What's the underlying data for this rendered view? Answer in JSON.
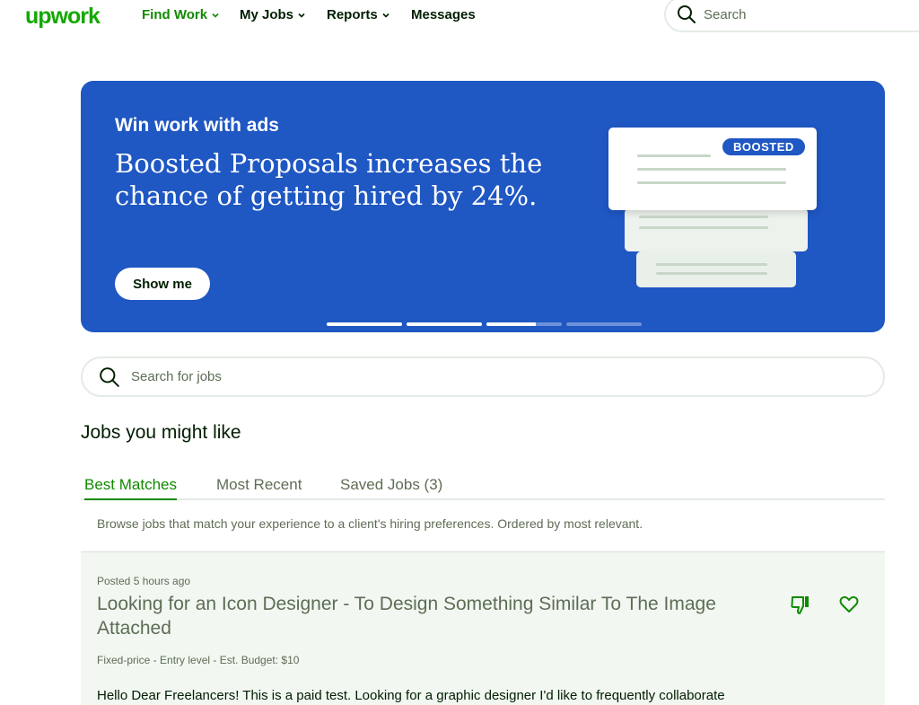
{
  "nav": {
    "logo": "upwork",
    "items": [
      {
        "label": "Find Work"
      },
      {
        "label": "My Jobs"
      },
      {
        "label": "Reports"
      },
      {
        "label": "Messages"
      }
    ],
    "search_placeholder": "Search"
  },
  "banner": {
    "eyebrow": "Win work with ads",
    "headline": "Boosted Proposals increases the chance of getting hired by 24%.",
    "cta": "Show me",
    "badge": "BOOSTED",
    "slide_progress": [
      1,
      1,
      0.65,
      0
    ]
  },
  "job_search": {
    "placeholder": "Search for jobs"
  },
  "section_title": "Jobs you might like",
  "tabs": [
    {
      "label": "Best Matches",
      "active": true
    },
    {
      "label": "Most Recent",
      "active": false
    },
    {
      "label": "Saved Jobs (3)",
      "active": false
    }
  ],
  "tab_description": "Browse jobs that match your experience to a client's hiring preferences. Ordered by most relevant.",
  "job": {
    "posted": "Posted 5 hours ago",
    "title": "Looking for an Icon Designer - To Design Something Similar To The Image Attached",
    "meta": "Fixed-price - Entry level - Est. Budget: $10",
    "description": "Hello Dear Freelancers! This is a paid test. Looking for a graphic designer I'd like to frequently collaborate"
  },
  "colors": {
    "brand_green": "#14a800",
    "banner_blue": "#1f57c3",
    "active_tab": "#108a00"
  },
  "icons": [
    "search-icon",
    "chevron-down-icon",
    "thumbs-down-icon",
    "heart-icon"
  ]
}
